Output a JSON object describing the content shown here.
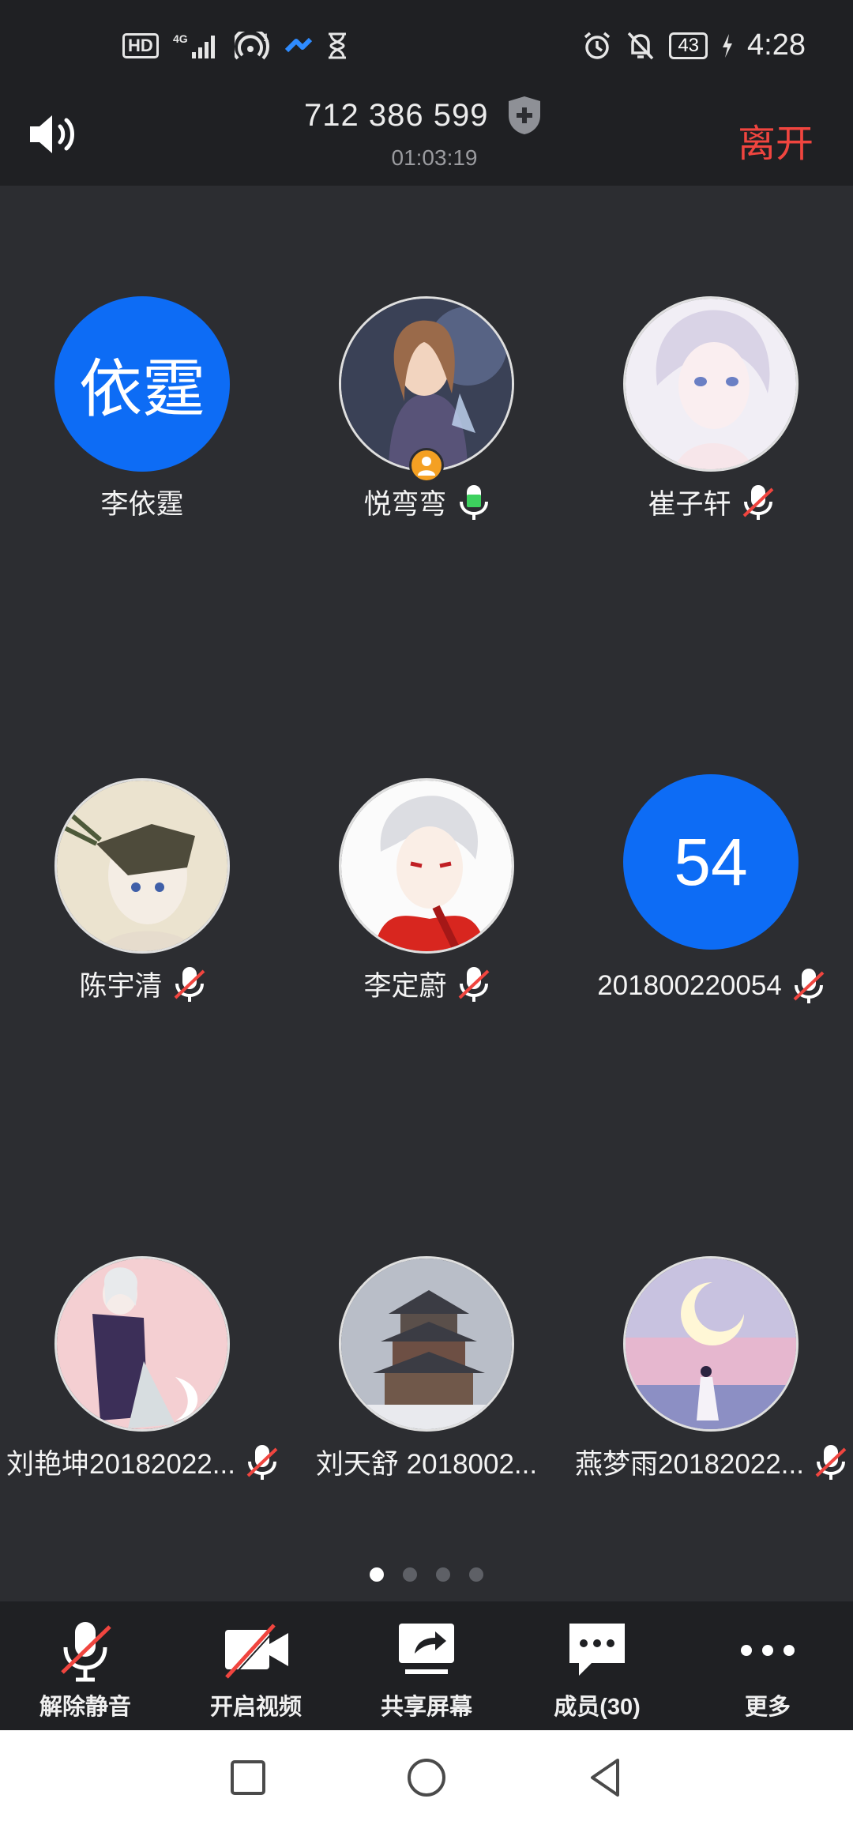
{
  "status_bar": {
    "left_icons": [
      "hd-icon",
      "4g-signal-icon",
      "hotspot-icon",
      "app-icon",
      "hourglass-icon"
    ],
    "hotspot_count": "1",
    "battery": "43",
    "time": "4:28",
    "right_icons": [
      "alarm-icon",
      "bell-off-icon",
      "battery-icon",
      "charging-icon"
    ]
  },
  "header": {
    "meeting_id": "712 386 599",
    "duration": "01:03:19",
    "leave_label": "离开"
  },
  "participants": [
    {
      "name": "李依霆",
      "avatar_text": "依霆",
      "mic": "none",
      "host": false
    },
    {
      "name": "悦弯弯",
      "mic": "on",
      "host": true
    },
    {
      "name": "崔子轩",
      "mic": "muted",
      "host": false
    },
    {
      "name": "陈宇清",
      "mic": "muted",
      "host": false
    },
    {
      "name": "李定蔚",
      "mic": "muted",
      "host": false
    },
    {
      "name": "201800220054",
      "avatar_text": "54",
      "mic": "muted",
      "host": false
    },
    {
      "name": "刘艳坤20182022...",
      "mic": "muted",
      "host": false
    },
    {
      "name": "刘天舒 2018002...",
      "mic": "none",
      "host": false
    },
    {
      "name": "燕梦雨20182022...",
      "mic": "muted",
      "host": false
    }
  ],
  "pagination": {
    "pages": 4,
    "current": 1
  },
  "toolbar": {
    "unmute_label": "解除静音",
    "video_label": "开启视频",
    "share_label": "共享屏幕",
    "members_label": "成员(30)",
    "more_label": "更多"
  },
  "colors": {
    "background": "#2c2d31",
    "bar": "#1f2023",
    "accent_blue": "#0d6cf5",
    "leave_red": "#f0453f",
    "mic_on_green": "#3dd15e"
  }
}
